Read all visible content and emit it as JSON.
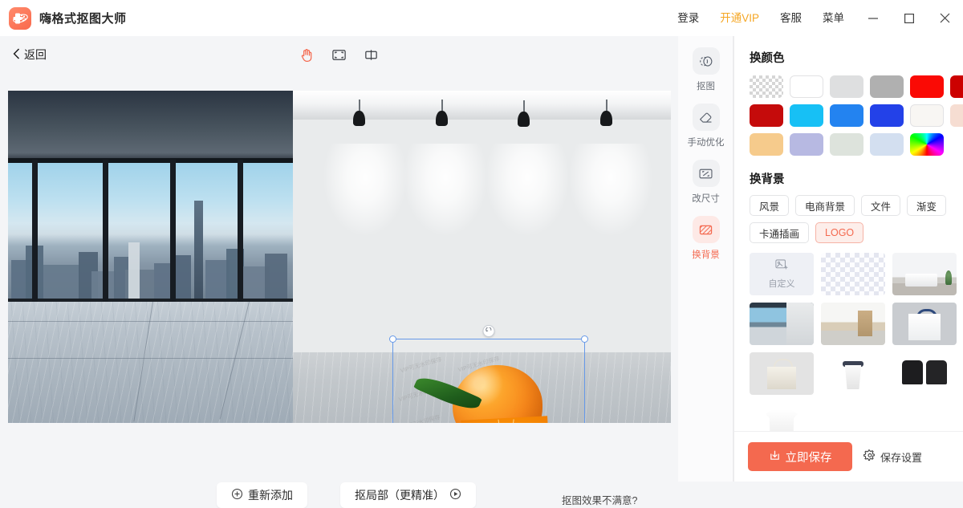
{
  "titlebar": {
    "app_title": "嗨格式抠图大师",
    "logo_icon": "app-logo-icon",
    "links": [
      {
        "label": "登录",
        "name": "login-link",
        "accent": false
      },
      {
        "label": "开通VIP",
        "name": "vip-link",
        "accent": true
      },
      {
        "label": "客服",
        "name": "support-link",
        "accent": false
      },
      {
        "label": "菜单",
        "name": "menu-link",
        "accent": false
      }
    ],
    "window_controls": [
      {
        "name": "minimize-button",
        "icon": "minimize-icon"
      },
      {
        "name": "maximize-button",
        "icon": "maximize-icon"
      },
      {
        "name": "close-button",
        "icon": "close-icon"
      }
    ],
    "vip_color": "#f5a623"
  },
  "editor": {
    "back_label": "返回",
    "back_icon": "chevron-left-icon",
    "canvas_tools": [
      {
        "name": "pan-tool",
        "icon": "hand-icon",
        "active": true
      },
      {
        "name": "fit-screen-tool",
        "icon": "fit-screen-icon",
        "active": false
      },
      {
        "name": "compare-tool",
        "icon": "split-compare-icon",
        "active": false
      }
    ],
    "watermark_text": "VIP可无水印保存",
    "selection": {
      "rotate_icon": "rotate-handle-icon",
      "handles": [
        "top-left",
        "top-right",
        "bottom-left",
        "bottom-right"
      ],
      "border_color": "#6699e8"
    },
    "actions": {
      "readd_label": "重新添加",
      "readd_icon": "plus-circle-icon",
      "partial_label": "抠局部（更精准）",
      "partial_icon": "play-circle-icon",
      "unsatisfied_label": "抠图效果不满意?"
    }
  },
  "tool_rail": [
    {
      "label": "抠图",
      "name": "tool-cutout",
      "icon": "cutout-icon",
      "active": false
    },
    {
      "label": "手动优化",
      "name": "tool-manual-refine",
      "icon": "eraser-icon",
      "active": false
    },
    {
      "label": "改尺寸",
      "name": "tool-resize",
      "icon": "resize-icon",
      "active": false
    },
    {
      "label": "换背景",
      "name": "tool-change-background",
      "icon": "change-bg-icon",
      "active": true
    }
  ],
  "panel": {
    "color_section_title": "换颜色",
    "swatches": [
      {
        "name": "swatch-transparent",
        "type": "checker",
        "color": "transparent"
      },
      {
        "name": "swatch-white",
        "type": "solid",
        "color": "#ffffff",
        "bordered": true
      },
      {
        "name": "swatch-light-gray",
        "type": "solid",
        "color": "#dedfe0"
      },
      {
        "name": "swatch-gray",
        "type": "solid",
        "color": "#b0b0b0"
      },
      {
        "name": "swatch-red",
        "type": "solid",
        "color": "#fa0a05"
      },
      {
        "name": "swatch-dark-red",
        "type": "solid",
        "color": "#cc0100"
      },
      {
        "name": "swatch-crimson",
        "type": "solid",
        "color": "#c50b0b"
      },
      {
        "name": "swatch-cyan",
        "type": "solid",
        "color": "#17c0f5"
      },
      {
        "name": "swatch-blue",
        "type": "solid",
        "color": "#2383f0"
      },
      {
        "name": "swatch-royal-blue",
        "type": "solid",
        "color": "#2341e8"
      },
      {
        "name": "swatch-off-white",
        "type": "solid",
        "color": "#f8f6f3",
        "bordered": true
      },
      {
        "name": "swatch-peach",
        "type": "solid",
        "color": "#f6ddd2"
      },
      {
        "name": "swatch-apricot",
        "type": "solid",
        "color": "#f6cb8c"
      },
      {
        "name": "swatch-periwinkle",
        "type": "solid",
        "color": "#b7b9e2"
      },
      {
        "name": "swatch-sage",
        "type": "solid",
        "color": "#dde3dc"
      },
      {
        "name": "swatch-ice-blue",
        "type": "solid",
        "color": "#d3dff0"
      },
      {
        "name": "swatch-custom-picker",
        "type": "rainbow",
        "color": "rainbow"
      }
    ],
    "background_section_title": "换背景",
    "background_tabs": [
      {
        "label": "风景",
        "name": "bgtab-scenery",
        "active": false
      },
      {
        "label": "电商背景",
        "name": "bgtab-ecommerce",
        "active": false
      },
      {
        "label": "文件",
        "name": "bgtab-document",
        "active": false
      },
      {
        "label": "渐变",
        "name": "bgtab-gradient",
        "active": false
      },
      {
        "label": "卡通插画",
        "name": "bgtab-cartoon",
        "active": false
      },
      {
        "label": "LOGO",
        "name": "bgtab-logo",
        "active": true
      }
    ],
    "thumbnails": [
      {
        "name": "thumb-custom-upload",
        "label": "自定义",
        "kind": "custom",
        "icon": "add-image-icon"
      },
      {
        "name": "thumb-transparent",
        "label": "",
        "kind": "checker"
      },
      {
        "name": "thumb-reception-desk",
        "label": "",
        "kind": "reception"
      },
      {
        "name": "thumb-city-window-wall",
        "label": "",
        "kind": "city"
      },
      {
        "name": "thumb-wood-corridor",
        "label": "",
        "kind": "corridor"
      },
      {
        "name": "thumb-shopping-bag",
        "label": "",
        "kind": "bag"
      },
      {
        "name": "thumb-tote-bag",
        "label": "",
        "kind": "tote"
      },
      {
        "name": "thumb-paper-cup",
        "label": "",
        "kind": "cup"
      },
      {
        "name": "thumb-black-tshirts",
        "label": "",
        "kind": "tshirts"
      },
      {
        "name": "thumb-white-tshirt",
        "label": "",
        "kind": "whitetee"
      }
    ],
    "footer": {
      "save_label": "立即保存",
      "save_icon": "download-icon",
      "save_settings_label": "保存设置",
      "save_settings_icon": "gear-icon",
      "save_color": "#f4694f"
    }
  }
}
